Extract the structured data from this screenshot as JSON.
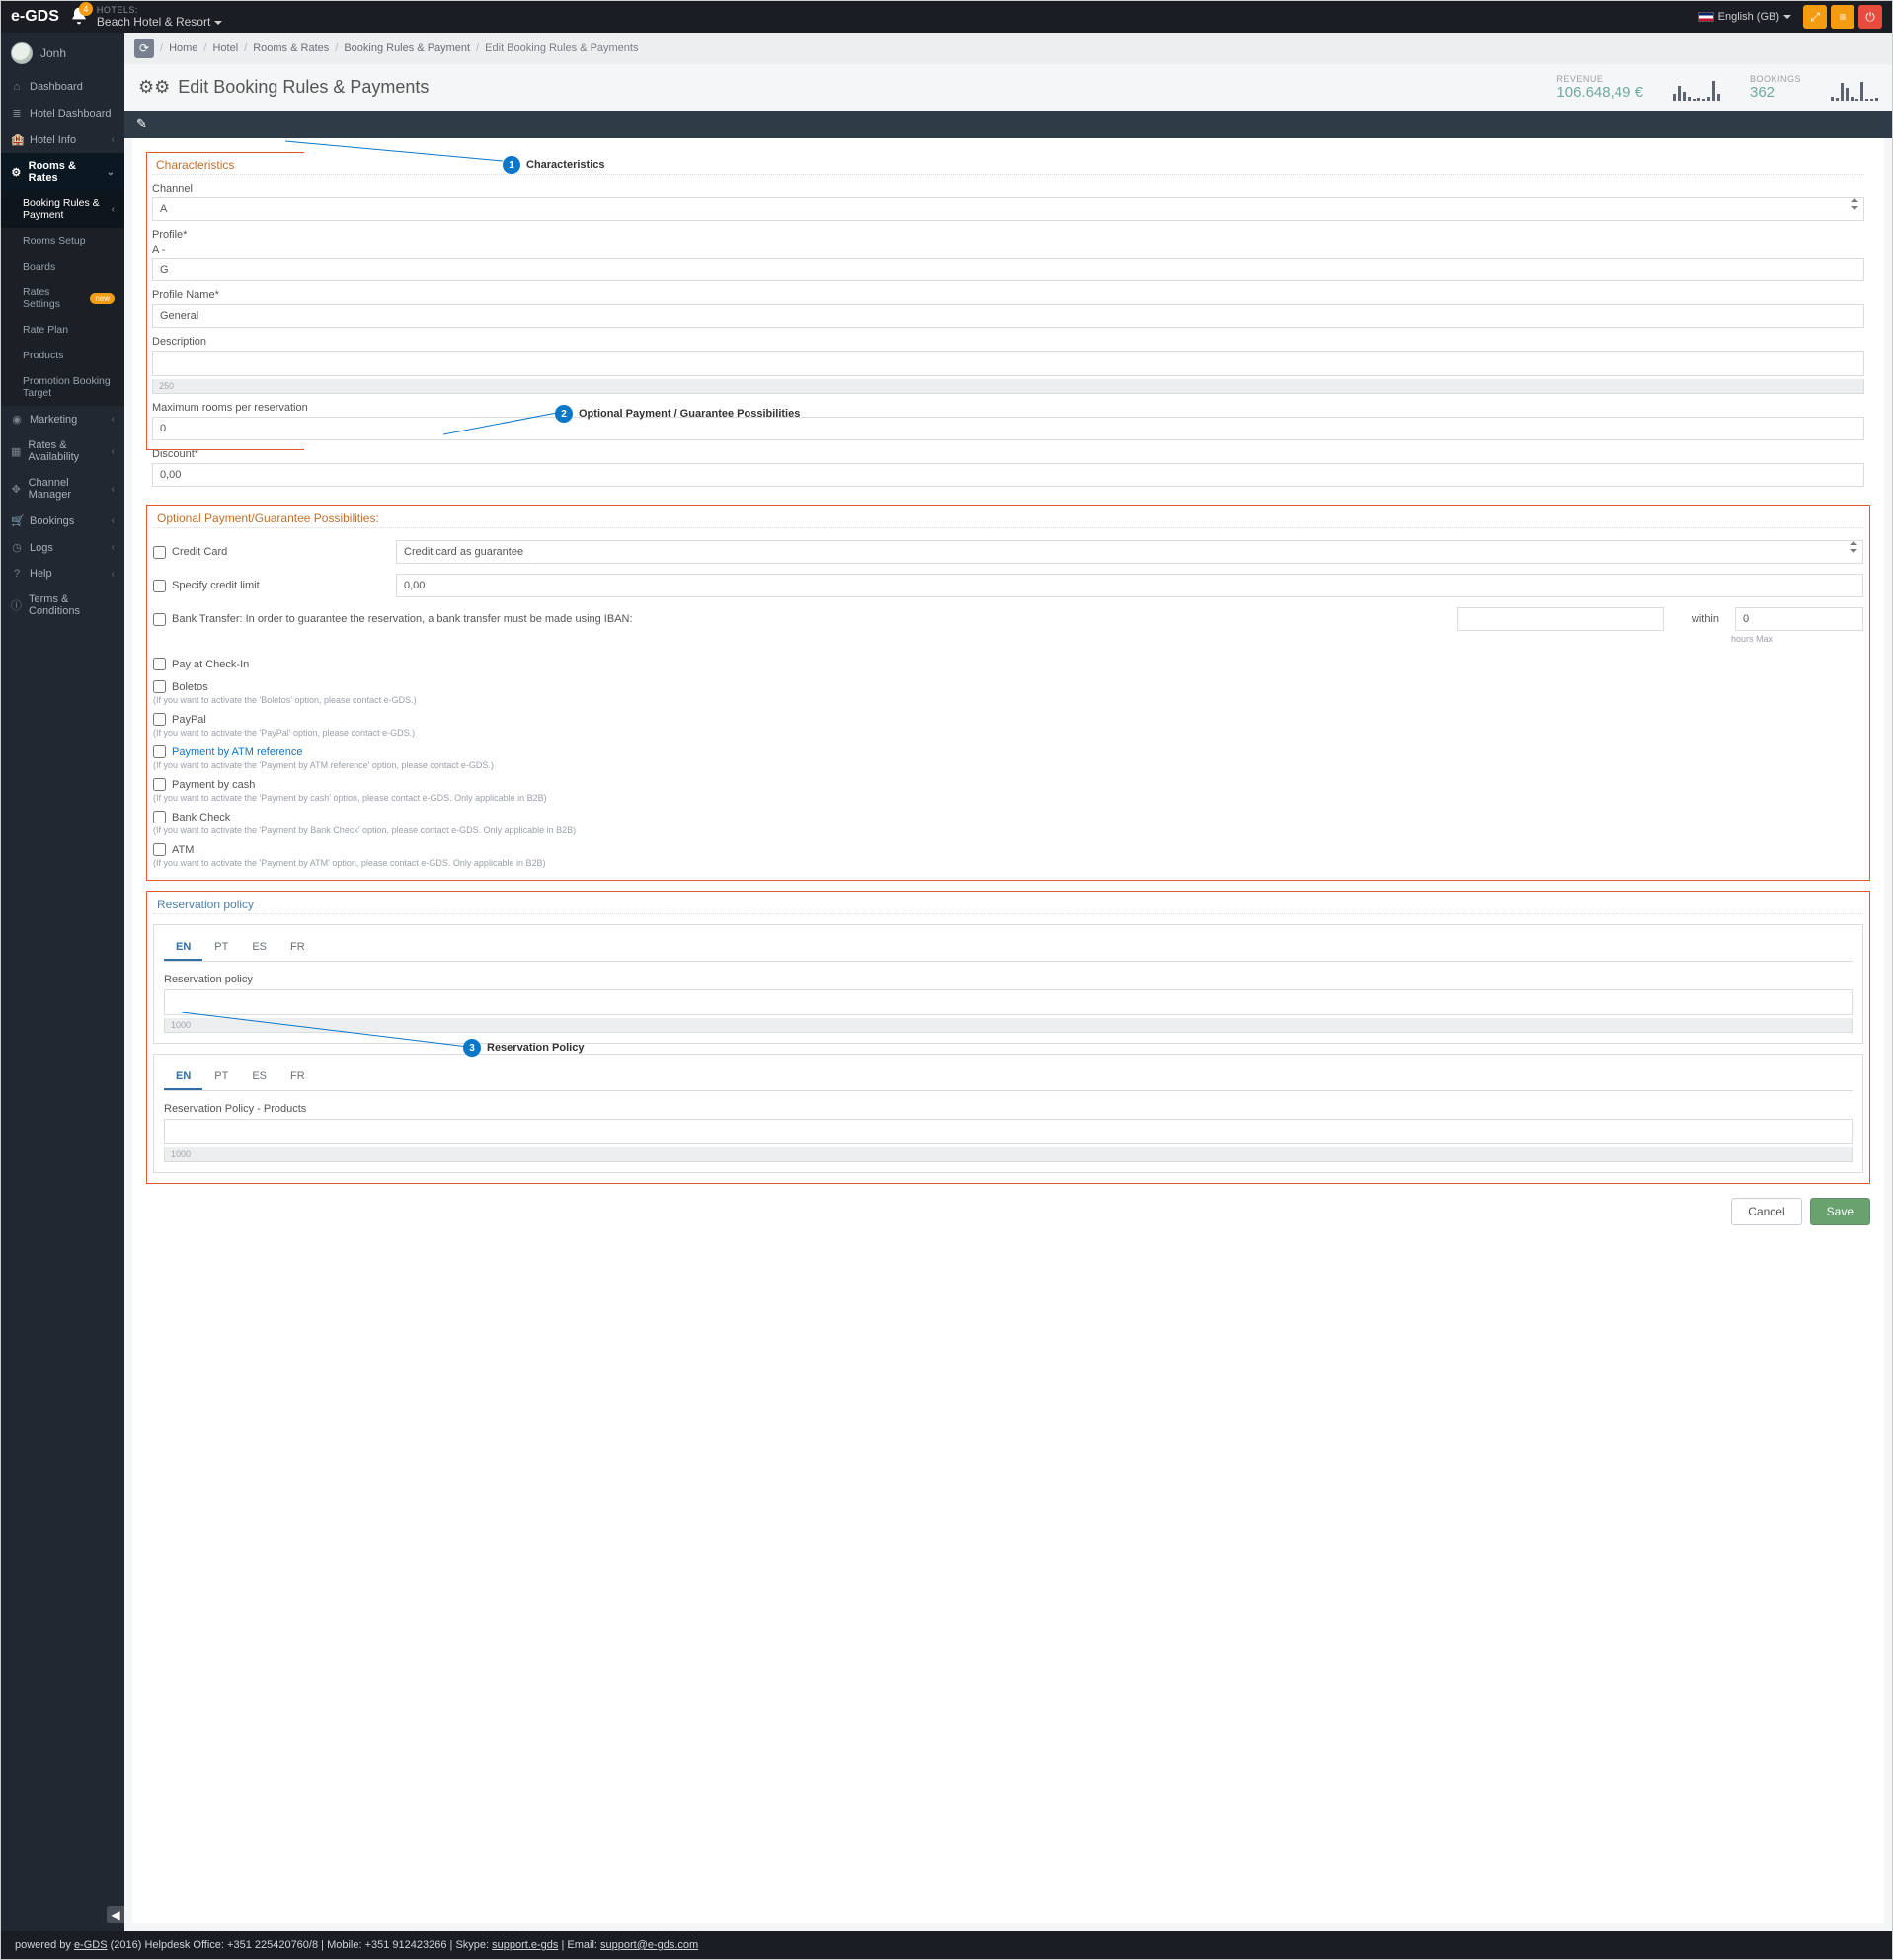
{
  "topbar": {
    "brand": "e-GDS",
    "notif_count": "4",
    "hotels_label": "HOTELS:",
    "hotel_name": "Beach Hotel & Resort",
    "language": "English (GB)"
  },
  "user": {
    "name": "Jonh"
  },
  "nav": {
    "dashboard": "Dashboard",
    "hotel_dashboard": "Hotel Dashboard",
    "hotel_info": "Hotel Info",
    "rooms_rates": "Rooms & Rates",
    "marketing": "Marketing",
    "rates_avail": "Rates & Availability",
    "channel_manager": "Channel Manager",
    "bookings": "Bookings",
    "logs": "Logs",
    "help": "Help",
    "terms": "Terms & Conditions",
    "sub": {
      "booking_rules": "Booking Rules & Payment",
      "rooms_setup": "Rooms Setup",
      "boards": "Boards",
      "rates_settings": "Rates Settings",
      "rates_settings_badge": "new",
      "rate_plan": "Rate Plan",
      "products": "Products",
      "promo_target": "Promotion Booking Target"
    }
  },
  "crumbs": {
    "home": "Home",
    "hotel": "Hotel",
    "rooms_rates": "Rooms & Rates",
    "booking_rules": "Booking Rules & Payment",
    "edit": "Edit Booking Rules & Payments"
  },
  "title": "Edit Booking Rules & Payments",
  "metrics": {
    "revenue_lbl": "REVENUE",
    "revenue_val": "106.648,49 €",
    "bookings_lbl": "BOOKINGS",
    "bookings_val": "362"
  },
  "sections": {
    "characteristics": "Characteristics",
    "payments": "Optional Payment/Guarantee Possibilities:",
    "reservation": "Reservation policy"
  },
  "callouts": {
    "c1": "Characteristics",
    "c2": "Optional Payment / Guarantee Possibilities",
    "c3": "Reservation Policy"
  },
  "form": {
    "channel_lbl": "Channel",
    "channel_val": "A",
    "profile_lbl": "Profile*",
    "profile_pre": "A -",
    "profile_val": "G",
    "profile_name_lbl": "Profile Name*",
    "profile_name_val": "General",
    "description_lbl": "Description",
    "description_counter": "250",
    "max_rooms_lbl": "Maximum rooms per reservation",
    "max_rooms_val": "0",
    "discount_lbl": "Discount*",
    "discount_val": "0,00"
  },
  "payments": {
    "credit_card": "Credit Card",
    "cc_select": "Credit card as guarantee",
    "specify_limit": "Specify credit limit",
    "specify_limit_val": "0,00",
    "bank_transfer": "Bank Transfer: In order to guarantee the reservation, a bank transfer must be made using IBAN:",
    "within": "within",
    "hours0": "0",
    "hours_max": "hours Max",
    "pay_checkin": "Pay at Check-In",
    "boletos": "Boletos",
    "boletos_note": "(If you want to activate the 'Boletos' option, please contact e-GDS.)",
    "paypal": "PayPal",
    "paypal_note": "(If you want to activate the 'PayPal' option, please contact e-GDS.)",
    "atm_ref": "Payment by ATM reference",
    "atm_ref_note": "(If you want to activate the 'Payment by ATM reference' option, please contact e-GDS.)",
    "cash": "Payment by cash",
    "cash_note": "(If you want to activate the 'Payment by cash' option, please contact e-GDS. Only applicable in B2B)",
    "bank_check": "Bank Check",
    "bank_check_note": "(If you want to activate the 'Payment by Bank Check' option, please contact e-GDS. Only applicable in B2B)",
    "atm": "ATM",
    "atm_note": "(If you want to activate the 'Payment by ATM' option, please contact e-GDS. Only applicable in B2B)"
  },
  "reservation": {
    "tabs": {
      "en": "EN",
      "pt": "PT",
      "es": "ES",
      "fr": "FR"
    },
    "policy_lbl": "Reservation policy",
    "policy_counter": "1000",
    "products_lbl": "Reservation Policy - Products",
    "products_counter": "1000"
  },
  "buttons": {
    "cancel": "Cancel",
    "save": "Save"
  },
  "footer": {
    "pre": "powered by ",
    "brand": "e-GDS",
    "post1": " (2016) Helpdesk Office: +351 225420760/8  |  Mobile: +351 912423266  |  Skype: ",
    "skype": "support.e-gds",
    "post2": "  |  Email: ",
    "email": "support@e-gds.com"
  }
}
